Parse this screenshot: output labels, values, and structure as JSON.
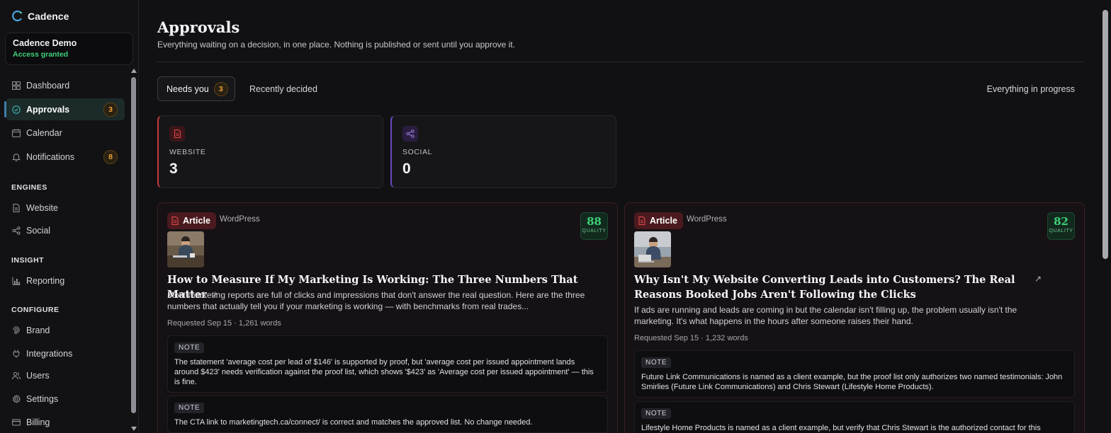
{
  "app": {
    "name": "Cadence"
  },
  "account": {
    "name": "Cadence Demo",
    "status": "Access granted"
  },
  "nav": {
    "dashboard": "Dashboard",
    "approvals": "Approvals",
    "approvals_badge": "3",
    "calendar": "Calendar",
    "notifications": "Notifications",
    "notifications_badge": "8",
    "sections": {
      "engines": "ENGINES",
      "insight": "INSIGHT",
      "configure": "CONFIGURE"
    },
    "website": "Website",
    "social": "Social",
    "reporting": "Reporting",
    "brand": "Brand",
    "integrations": "Integrations",
    "users": "Users",
    "settings": "Settings",
    "billing": "Billing"
  },
  "page": {
    "title": "Approvals",
    "subtitle": "Everything waiting on a decision, in one place. Nothing is published or sent until you approve it."
  },
  "tabs": {
    "needs_you": "Needs you",
    "needs_you_count": "3",
    "recently_decided": "Recently decided",
    "everything_in_progress": "Everything in progress"
  },
  "stats": {
    "website": {
      "label": "WEBSITE",
      "value": "3"
    },
    "social": {
      "label": "SOCIAL",
      "value": "0"
    }
  },
  "articles": [
    {
      "type": "Article",
      "platform": "WordPress",
      "quality": "88",
      "quality_label": "QUALITY",
      "title": "How to Measure If My Marketing Is Working: The Three Numbers That Matter",
      "description": "Most marketing reports are full of clicks and impressions that don't answer the real question. Here are the three numbers that actually tell you if your marketing is working — with benchmarks from real trades...",
      "meta": "Requested Sep 15 · 1,261 words",
      "notes": [
        {
          "label": "NOTE",
          "text": "The statement 'average cost per lead of $146' is supported by proof, but 'average cost per issued appointment lands around $423' needs verification against the proof list, which shows '$423' as 'Average cost per issued appointment' — this is fine."
        },
        {
          "label": "NOTE",
          "text": "The CTA link to marketingtech.ca/connect/ is correct and matches the approved list. No change needed."
        }
      ]
    },
    {
      "type": "Article",
      "platform": "WordPress",
      "quality": "82",
      "quality_label": "QUALITY",
      "title": "Why Isn't My Website Converting Leads into Customers? The Real Reasons Booked Jobs Aren't Following the Clicks",
      "description": "If ads are running and leads are coming in but the calendar isn't filling up, the problem usually isn't the marketing. It's what happens in the hours after someone raises their hand.",
      "meta": "Requested Sep 15 · 1,232 words",
      "notes": [
        {
          "label": "NOTE",
          "text": "Future Link Communications is named as a client example, but the proof list only authorizes two named testimonials: John Smirlies (Future Link Communications) and Chris Stewart (Lifestyle Home Products)."
        },
        {
          "label": "NOTE",
          "text": "Lifestyle Home Products is named as a client example, but verify that Chris Stewart is the authorized contact for this testimonial. The proof list names Chris Stewart (Lifestyle Home Products) — the name and company align, so the"
        }
      ]
    }
  ],
  "colors": {
    "accent_green": "#3fd17a",
    "badge_orange": "#f0a23a",
    "website_red": "#c43a3a",
    "social_purple": "#6b46c1"
  }
}
